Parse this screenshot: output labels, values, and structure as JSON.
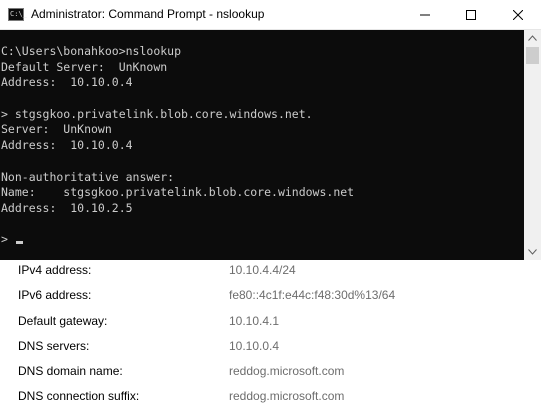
{
  "window": {
    "title": "Administrator: Command Prompt - nslookup",
    "app_icon": "command-prompt-icon",
    "icon_text": "C:\\_"
  },
  "console": {
    "lines": [
      "C:\\Users\\bonahkoo>nslookup",
      "Default Server:  UnKnown",
      "Address:  10.10.0.4",
      "",
      "> stgsgkoo.privatelink.blob.core.windows.net.",
      "Server:  UnKnown",
      "Address:  10.10.0.4",
      "",
      "Non-authoritative answer:",
      "Name:    stgsgkoo.privatelink.blob.core.windows.net",
      "Address:  10.10.2.5",
      "",
      "> "
    ]
  },
  "properties": [
    {
      "label": "IPv4 address:",
      "value": "10.10.4.4/24"
    },
    {
      "label": "IPv6 address:",
      "value": "fe80::4c1f:e44c:f48:30d%13/64"
    },
    {
      "label": "Default gateway:",
      "value": "10.10.4.1"
    },
    {
      "label": "DNS servers:",
      "value": "10.10.0.4"
    },
    {
      "label": "DNS domain name:",
      "value": "reddog.microsoft.com"
    },
    {
      "label": "DNS connection suffix:",
      "value": "reddog.microsoft.com"
    }
  ],
  "colors": {
    "console_bg": "#0c0c0c",
    "console_fg": "#cccccc",
    "value_text": "#6d6d6d"
  }
}
